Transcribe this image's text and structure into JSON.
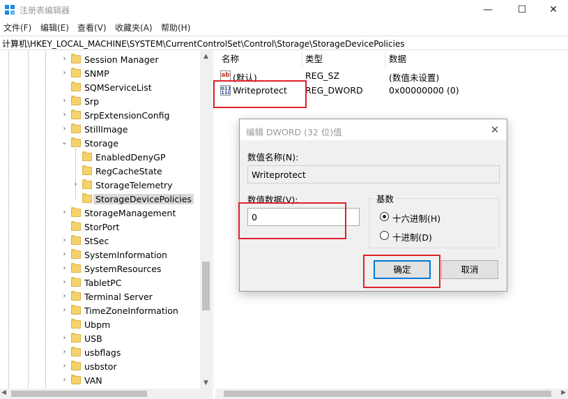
{
  "window": {
    "title": "注册表编辑器",
    "min_glyph": "—",
    "max_glyph": "☐",
    "close_glyph": "✕"
  },
  "menu": [
    "文件(F)",
    "编辑(E)",
    "查看(V)",
    "收藏夹(A)",
    "帮助(H)"
  ],
  "address": "计算机\\HKEY_LOCAL_MACHINE\\SYSTEM\\CurrentControlSet\\Control\\Storage\\StorageDevicePolicies",
  "tree": {
    "items": [
      {
        "label": "Session Manager",
        "expander": "›"
      },
      {
        "label": "SNMP",
        "expander": "›"
      },
      {
        "label": "SQMServiceList",
        "expander": ""
      },
      {
        "label": "Srp",
        "expander": "›"
      },
      {
        "label": "SrpExtensionConfig",
        "expander": "›"
      },
      {
        "label": "StillImage",
        "expander": "›"
      },
      {
        "label": "Storage",
        "expander": "⌄"
      },
      {
        "label": "EnabledDenyGP",
        "expander": ""
      },
      {
        "label": "RegCacheState",
        "expander": ""
      },
      {
        "label": "StorageTelemetry",
        "expander": "›"
      },
      {
        "label": "StorageDevicePolicies",
        "expander": ""
      },
      {
        "label": "StorageManagement",
        "expander": "›"
      },
      {
        "label": "StorPort",
        "expander": ""
      },
      {
        "label": "StSec",
        "expander": "›"
      },
      {
        "label": "SystemInformation",
        "expander": "›"
      },
      {
        "label": "SystemResources",
        "expander": "›"
      },
      {
        "label": "TabletPC",
        "expander": "›"
      },
      {
        "label": "Terminal Server",
        "expander": "›"
      },
      {
        "label": "TimeZoneInformation",
        "expander": "›"
      },
      {
        "label": "Ubpm",
        "expander": ""
      },
      {
        "label": "USB",
        "expander": "›"
      },
      {
        "label": "usbflags",
        "expander": "›"
      },
      {
        "label": "usbstor",
        "expander": "›"
      },
      {
        "label": "VAN",
        "expander": "›"
      }
    ],
    "selected": "StorageDevicePolicies"
  },
  "list": {
    "headers": [
      "名称",
      "类型",
      "数据"
    ],
    "rows": [
      {
        "icon": "ab",
        "name": "(默认)",
        "type": "REG_SZ",
        "data": "(数值未设置)"
      },
      {
        "icon": "011\n110",
        "name": "Writeprotect",
        "type": "REG_DWORD",
        "data": "0x00000000 (0)"
      }
    ]
  },
  "dialog": {
    "title": "编辑 DWORD (32 位)值",
    "close_glyph": "✕",
    "name_label": "数值名称(N):",
    "name_value": "Writeprotect",
    "data_label": "数值数据(V):",
    "data_value": "0",
    "base_label": "基数",
    "radio_hex": "十六进制(H)",
    "radio_dec": "十进制(D)",
    "selected_base": "hex",
    "ok_label": "确定",
    "cancel_label": "取消"
  },
  "colors": {
    "highlight": "#e0202a",
    "folder": "#f5d26a",
    "accent": "#0078d7"
  }
}
